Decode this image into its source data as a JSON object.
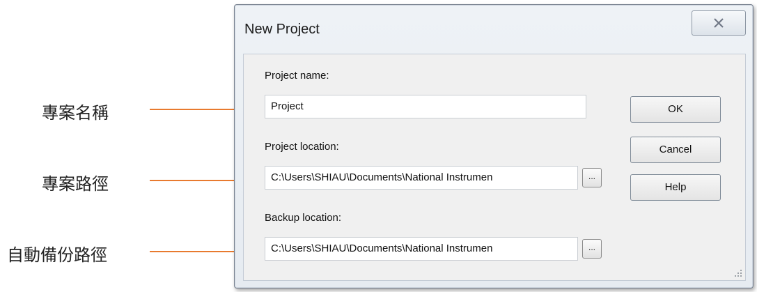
{
  "annotations": [
    {
      "label": "專案名稱"
    },
    {
      "label": "專案路徑"
    },
    {
      "label": "自動備份路徑"
    }
  ],
  "colors": {
    "arrow": "#e87a2f",
    "dialog_bg": "#f0f0f0"
  },
  "dialog": {
    "title": "New Project",
    "close_icon": "close-icon",
    "project_name": {
      "label": "Project name:",
      "value": "Project"
    },
    "project_location": {
      "label": "Project location:",
      "value": "C:\\Users\\SHIAU\\Documents\\National Instrumen",
      "browse_label": "..."
    },
    "backup_location": {
      "label": "Backup location:",
      "value": "C:\\Users\\SHIAU\\Documents\\National Instrumen",
      "browse_label": "..."
    },
    "buttons": {
      "ok": "OK",
      "cancel": "Cancel",
      "help": "Help"
    }
  }
}
